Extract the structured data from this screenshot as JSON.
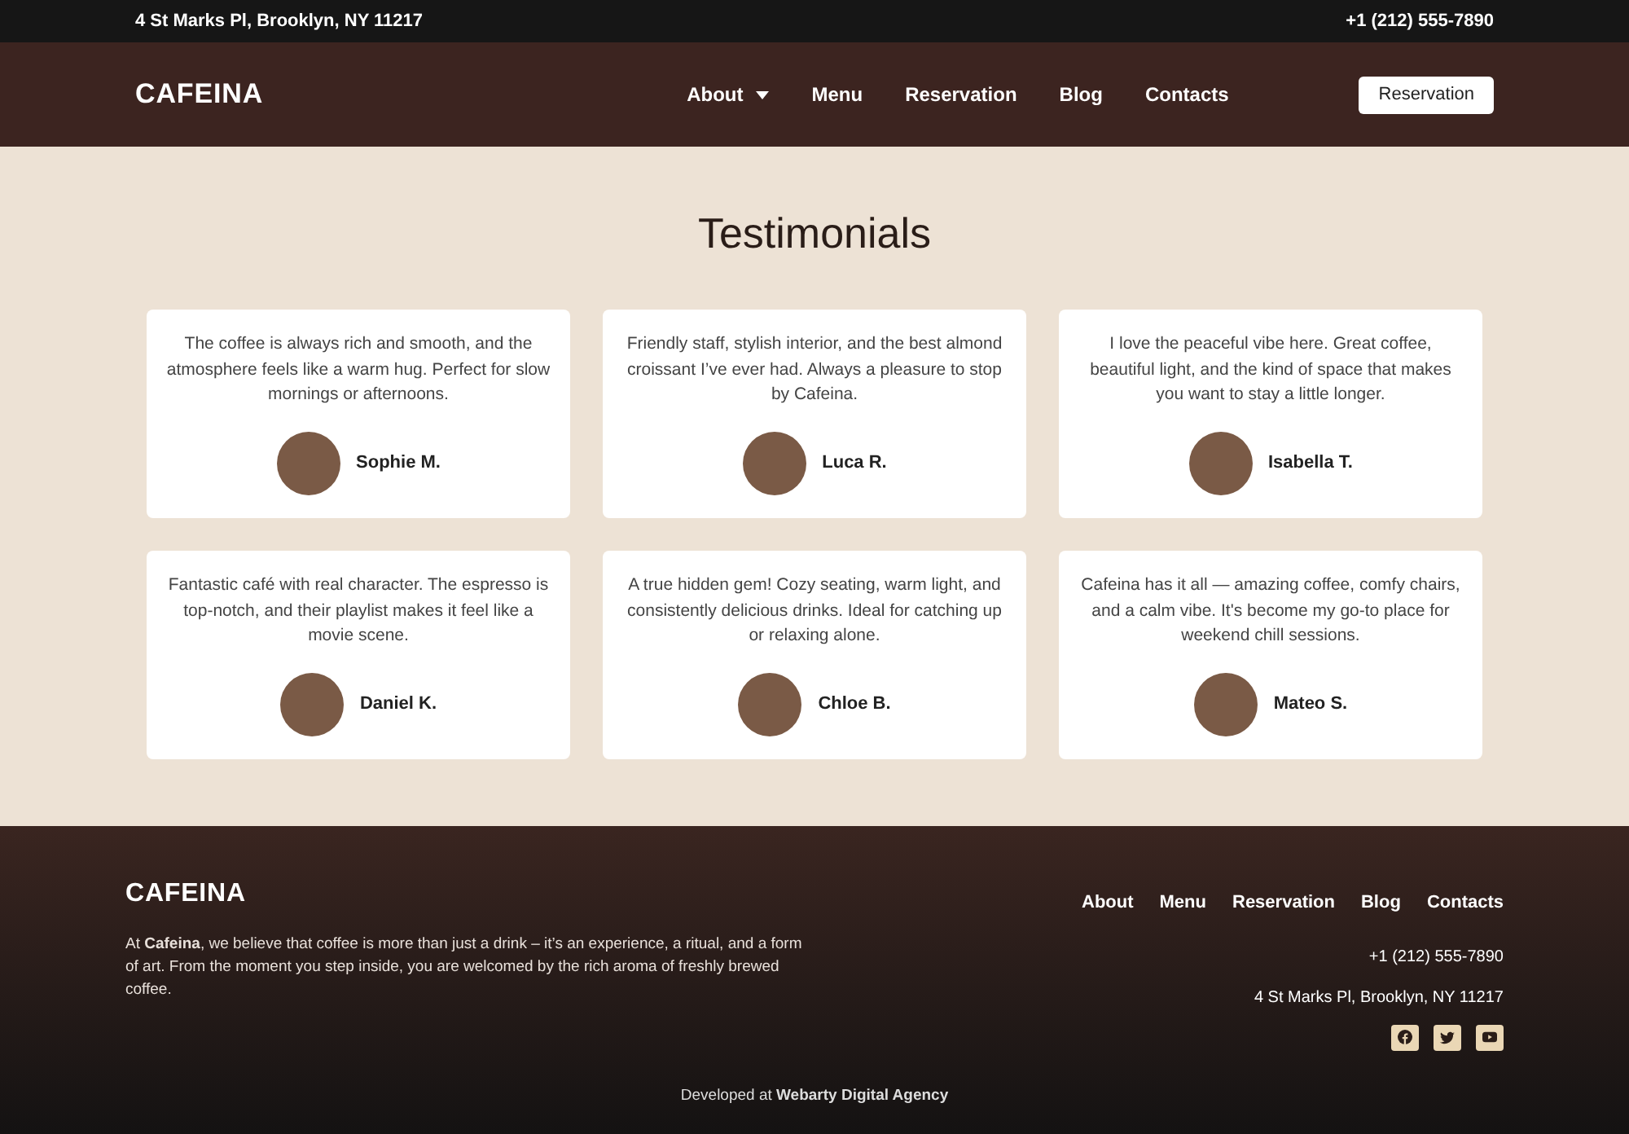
{
  "top_bar": {
    "address": "4 St Marks Pl, Brooklyn, NY 11217",
    "phone": "+1 (212) 555-7890"
  },
  "header": {
    "logo": "CAFEINA",
    "nav": [
      {
        "label": "About",
        "kind": "dropdown"
      },
      {
        "label": "Menu",
        "kind": "link"
      },
      {
        "label": "Reservation",
        "kind": "link"
      },
      {
        "label": "Blog",
        "kind": "link"
      },
      {
        "label": "Contacts",
        "kind": "link"
      }
    ],
    "cta": "Reservation"
  },
  "testimonials": {
    "title": "Testimonials",
    "items": [
      {
        "quote": "The coffee is always rich and smooth, and the atmosphere feels like a warm hug. Perfect for slow mornings or afternoons.",
        "name": "Sophie M."
      },
      {
        "quote": "Friendly staff, stylish interior, and the best almond croissant I’ve ever had. Always a pleasure to stop by Cafeina.",
        "name": "Luca R."
      },
      {
        "quote": "I love the peaceful vibe here. Great coffee, beautiful light, and the kind of space that makes you want to stay a little longer.",
        "name": "Isabella T."
      },
      {
        "quote": "Fantastic café with real character. The espresso is top-notch, and their playlist makes it feel like a movie scene.",
        "name": "Daniel K."
      },
      {
        "quote": "A true hidden gem! Cozy seating, warm light, and consistently delicious drinks. Ideal for catching up or relaxing alone.",
        "name": "Chloe B."
      },
      {
        "quote": "Cafeina has it all — amazing coffee, comfy chairs, and a calm vibe. It's become my go-to place for weekend chill sessions.",
        "name": "Mateo S."
      }
    ]
  },
  "footer": {
    "logo": "CAFEINA",
    "about": "At **Cafeina**, we believe that coffee is more than just a drink – it’s an experience, a ritual, and a form of art. From the moment you step inside, you are welcomed by the rich aroma of freshly brewed coffee.",
    "nav": [
      "About",
      "Menu",
      "Reservation",
      "Blog",
      "Contacts"
    ],
    "phone": "+1 (212) 555-7890",
    "address": "4 St Marks Pl, Brooklyn, NY 11217",
    "credit": "Developed at **Webarty Digital Agency**"
  }
}
